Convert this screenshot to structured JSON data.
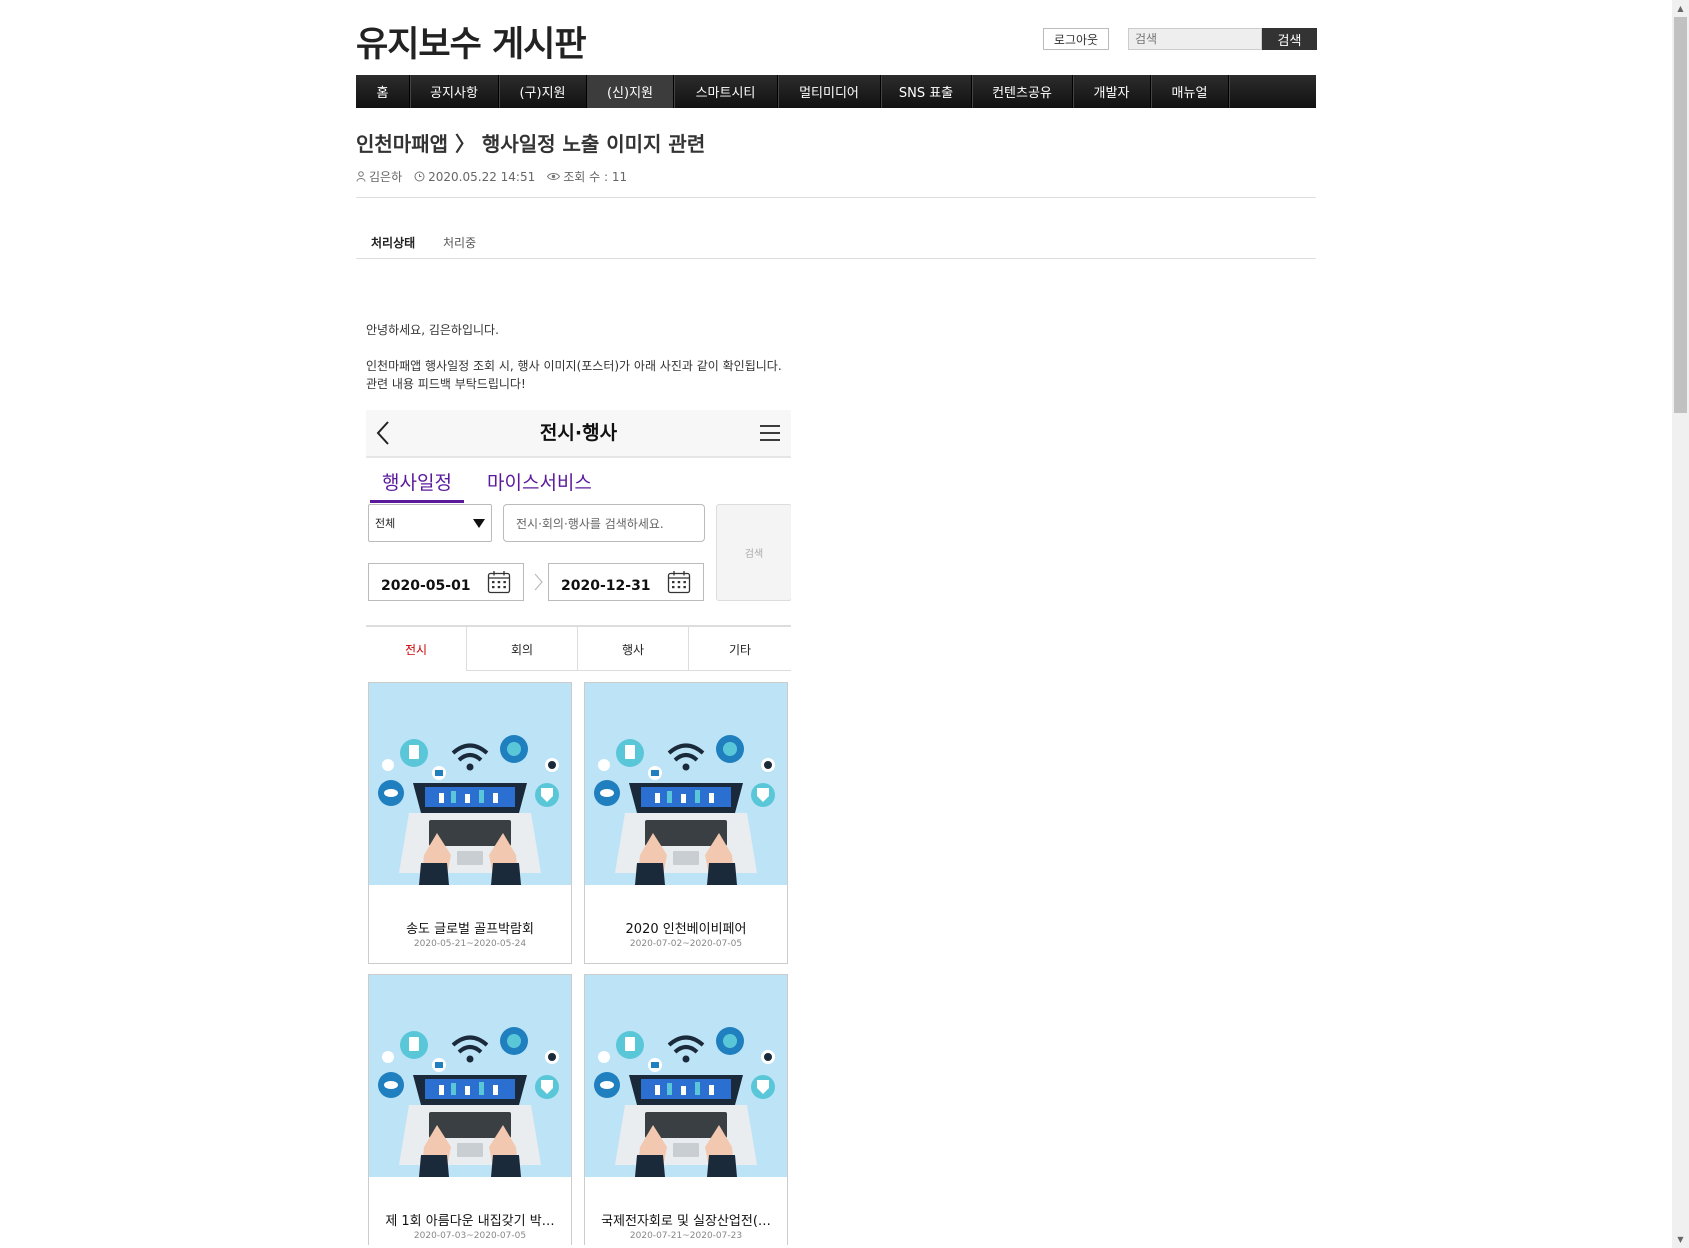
{
  "site": {
    "title": "유지보수 게시판"
  },
  "header": {
    "logout_label": "로그아웃",
    "search_placeholder": "검색",
    "search_button": "검색"
  },
  "nav": {
    "items": [
      "홈",
      "공지사항",
      "(구)지원",
      "(신)지원",
      "스마트시티",
      "멀티미디어",
      "SNS 표출",
      "컨텐츠공유",
      "개발자",
      "매뉴얼"
    ],
    "active_index": 3
  },
  "post": {
    "title": "인천마패앱 〉 행사일정 노출 이미지 관련",
    "author": "김은하",
    "datetime": "2020.05.22 14:51",
    "views": "조회 수 : 11",
    "status_label": "처리상태",
    "status_value": "처리중",
    "body_lines": [
      "안녕하세요, 김은하입니다.",
      "인천마패앱 행사일정 조회 시, 행사 이미지(포스터)가 아래 사진과 같이 확인됩니다.",
      "관련 내용 피드백 부탁드립니다!"
    ]
  },
  "screenshot": {
    "header_title": "전시·행사",
    "tabs": [
      "행사일정",
      "마이스서비스"
    ],
    "select_value": "전체",
    "keyword_placeholder": "전시·회의·행사를 검색하세요.",
    "search_label": "검색",
    "date_from": "2020-05-01",
    "date_to": "2020-12-31",
    "categories": [
      "전시",
      "회의",
      "행사",
      "기타"
    ],
    "events": [
      {
        "title": "송도 글로벌 골프박람회",
        "date": "2020-05-21~2020-05-24"
      },
      {
        "title": "2020 인천베이비페어",
        "date": "2020-07-02~2020-07-05"
      },
      {
        "title": "제 1회 아름다운 내집갖기 박…",
        "date": "2020-07-03~2020-07-05"
      },
      {
        "title": "국제전자회로 및 실장산업전(…",
        "date": "2020-07-21~2020-07-23"
      }
    ]
  },
  "colors": {
    "nav_bg": "#1a1a1a",
    "accent_purple": "#5b1a9c",
    "active_category": "#cc0000",
    "image_bg": "#bde3f7"
  }
}
